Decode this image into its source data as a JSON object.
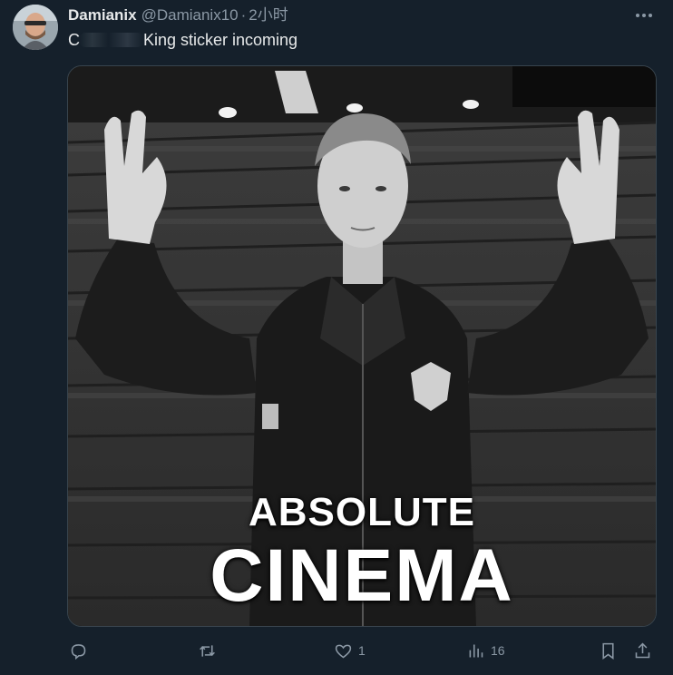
{
  "tweet": {
    "display_name": "Damianix",
    "handle": "@Damianix10",
    "separator": "·",
    "time": "2小时",
    "text_prefix": "C",
    "text_suffix": "King sticker incoming",
    "more_icon": "more-dots-icon"
  },
  "media": {
    "caption_top": "ABSOLUTE",
    "caption_bottom": "CINEMA"
  },
  "actions": {
    "reply_icon": "reply-icon",
    "retweet_icon": "retweet-icon",
    "like_icon": "heart-icon",
    "like_count": "1",
    "views_icon": "bar-chart-icon",
    "views_count": "16",
    "bookmark_icon": "bookmark-icon",
    "share_icon": "share-icon"
  },
  "colors": {
    "background": "#15202b",
    "text_primary": "#e7e9ea",
    "text_secondary": "#8b98a5",
    "border": "#38444d"
  }
}
